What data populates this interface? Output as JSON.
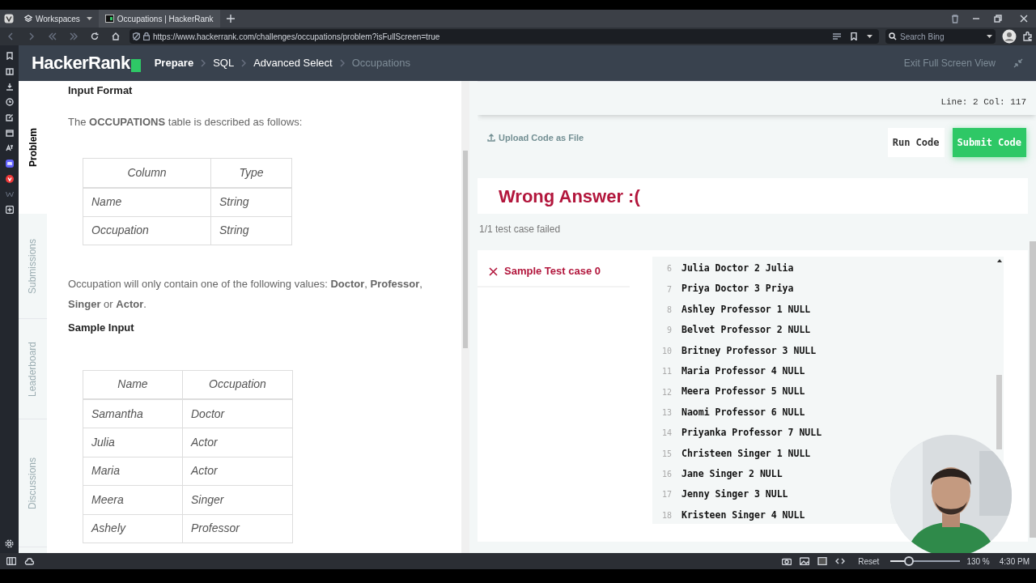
{
  "browser": {
    "tabs": [
      {
        "label": "Workspaces",
        "kind": "workspaces",
        "selected": false
      },
      {
        "label": "Occupations | HackerRank",
        "kind": "page",
        "selected": true
      }
    ],
    "url": "https://www.hackerrank.com/challenges/occupations/problem?isFullScreen=true",
    "search": {
      "placeholder": "Search Bing"
    }
  },
  "header": {
    "logo": "HackerRank",
    "breadcrumbs": [
      {
        "label": "Prepare",
        "current": false,
        "strong": true
      },
      {
        "label": "SQL",
        "current": false,
        "strong": false
      },
      {
        "label": "Advanced Select",
        "current": false,
        "strong": false
      },
      {
        "label": "Occupations",
        "current": true,
        "strong": false
      }
    ],
    "exit": "Exit Full Screen View"
  },
  "side_tabs": [
    {
      "label": "Problem",
      "selected": true
    },
    {
      "label": "Submissions",
      "selected": false
    },
    {
      "label": "Leaderboard",
      "selected": false
    },
    {
      "label": "Discussions",
      "selected": false
    }
  ],
  "problem": {
    "heading": "Input Format",
    "intro": "The **OCCUPATIONS** table is described as follows:",
    "schema_table": {
      "columns": [
        "Column",
        "Type"
      ],
      "rows": [
        [
          "Name",
          "String"
        ],
        [
          "Occupation",
          "String"
        ]
      ]
    },
    "note": "Occupation will only contain one of the following values: **Doctor**, **Professor**, **Singer** or **Actor**.",
    "sample_heading": "Sample Input",
    "sample_table": {
      "columns": [
        "Name",
        "Occupation"
      ],
      "rows": [
        [
          "Samantha",
          "Doctor"
        ],
        [
          "Julia",
          "Actor"
        ],
        [
          "Maria",
          "Actor"
        ],
        [
          "Meera",
          "Singer"
        ],
        [
          "Ashely",
          "Professor"
        ]
      ]
    }
  },
  "editor": {
    "cursor": "Line: 2 Col: 117",
    "upload": "Upload Code as File",
    "buttons": [
      {
        "label": "Run Code",
        "kind": "secondary"
      },
      {
        "label": "Submit Code",
        "kind": "primary"
      }
    ]
  },
  "result": {
    "title": "Wrong Answer :(",
    "summary": "1/1 test case failed",
    "test_case": {
      "label": "Sample Test case 0",
      "passed": false
    },
    "output": [
      {
        "n": "6",
        "text": "Julia Doctor 2 Julia"
      },
      {
        "n": "7",
        "text": "Priya Doctor 3 Priya"
      },
      {
        "n": "8",
        "text": "Ashley Professor 1 NULL"
      },
      {
        "n": "9",
        "text": "Belvet Professor 2 NULL"
      },
      {
        "n": "10",
        "text": "Britney Professor 3 NULL"
      },
      {
        "n": "11",
        "text": "Maria Professor 4 NULL"
      },
      {
        "n": "12",
        "text": "Meera Professor 5 NULL"
      },
      {
        "n": "13",
        "text": "Naomi Professor 6 NULL"
      },
      {
        "n": "14",
        "text": "Priyanka Professor 7 NULL"
      },
      {
        "n": "15",
        "text": "Christeen Singer 1 NULL"
      },
      {
        "n": "16",
        "text": "Jane Singer 2 NULL"
      },
      {
        "n": "17",
        "text": "Jenny Singer 3 NULL"
      },
      {
        "n": "18",
        "text": "Kristeen Singer 4 NULL"
      }
    ]
  },
  "status_bar": {
    "reset": "Reset",
    "zoom": {
      "level": 0.26
    },
    "zoom_text": "130 %",
    "time": "4:30 PM"
  }
}
